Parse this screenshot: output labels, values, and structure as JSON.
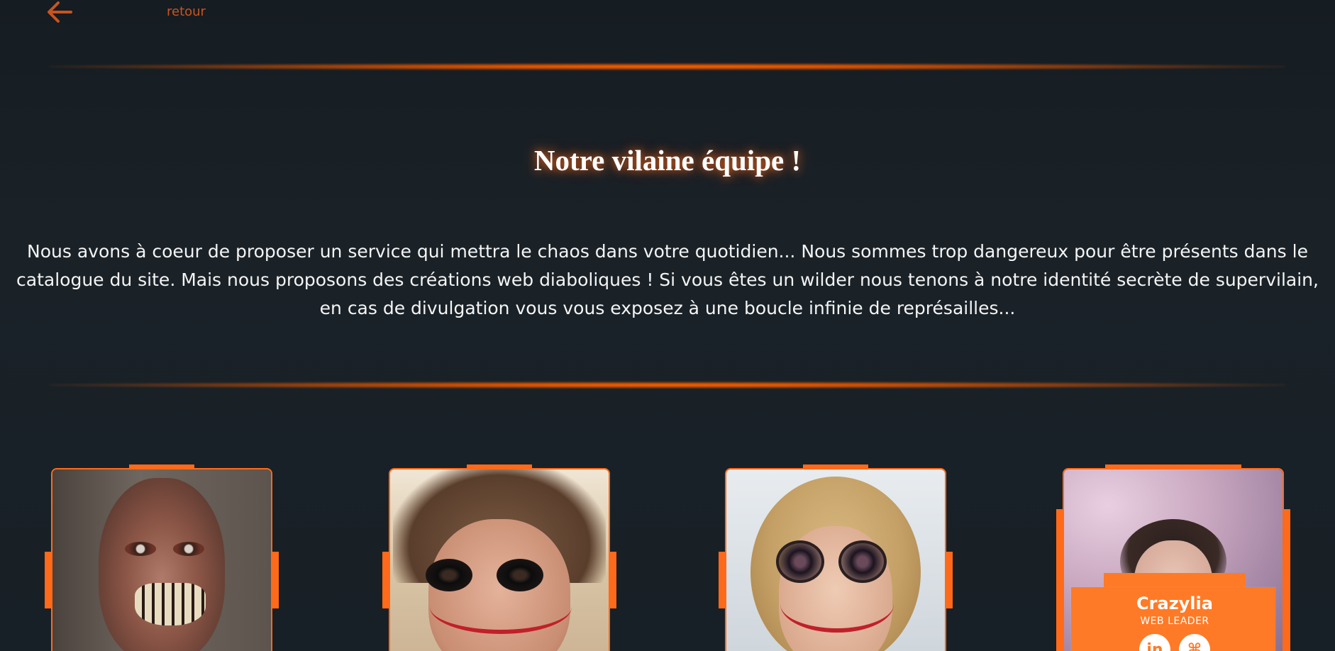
{
  "nav": {
    "back_label": "retour",
    "accent_color": "#c9541f"
  },
  "page": {
    "title": "Notre vilaine équipe !",
    "intro": "Nous avons à coeur de proposer un service qui mettra le chaos dans votre quotidien... Nous sommes trop dangereux pour être présents dans le catalogue du site. Mais nous proposons des créations web diaboliques ! Si vous êtes un wilder nous tenons à notre identité secrète de supervilain, en cas de divulgation vous vous exposez à une boucle infinie de représailles..."
  },
  "colors": {
    "background": "#1a2228",
    "accent": "#ff6a1a",
    "glow": "#ff6a00"
  },
  "team": [
    {
      "photo_icon": "member-photo-zombie"
    },
    {
      "photo_icon": "member-photo-joker-man"
    },
    {
      "photo_icon": "member-photo-joker-woman"
    },
    {
      "photo_icon": "member-photo-cherry-blossom",
      "name": "Crazylia",
      "role": "WEB LEADER",
      "social": [
        {
          "icon": "linkedin-icon",
          "glyph": "in"
        },
        {
          "icon": "github-icon",
          "glyph": "⌘"
        }
      ]
    }
  ]
}
